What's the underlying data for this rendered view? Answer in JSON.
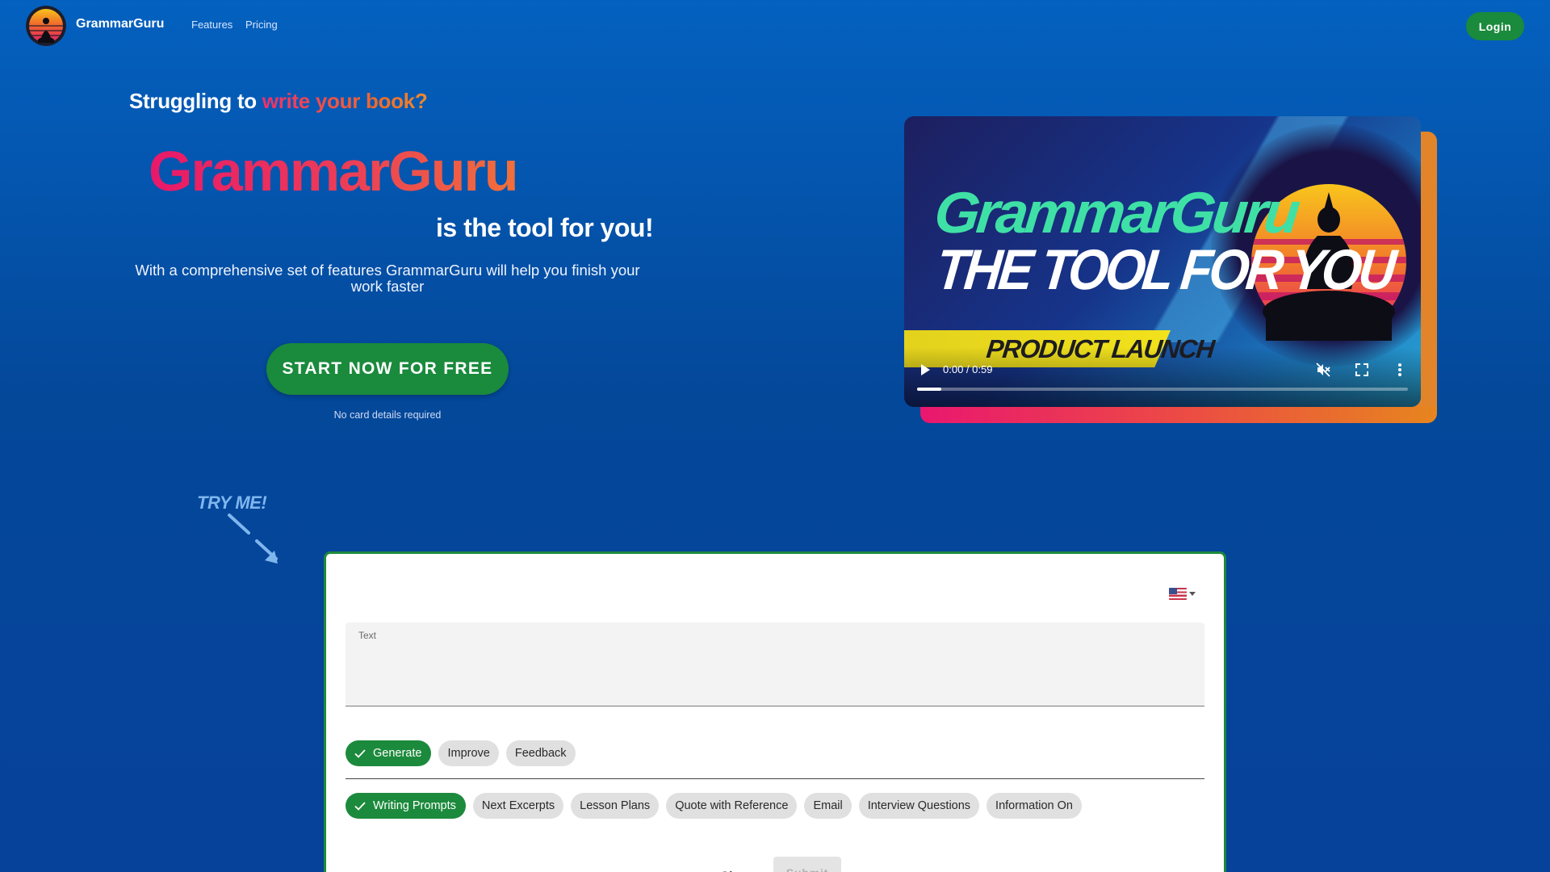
{
  "nav": {
    "brand": "GrammarGuru",
    "links": [
      "Features",
      "Pricing"
    ],
    "login_label": "Login"
  },
  "hero": {
    "headline_prefix": "Struggling to ",
    "headline_highlight": "write your book?",
    "brand": "GrammarGuru",
    "tagline": "is the tool for you!",
    "description": "With a comprehensive set of features GrammarGuru will help you finish your work faster",
    "cta_label": "START NOW FOR FREE",
    "cta_note": "No card details required"
  },
  "video": {
    "title_line1": "GrammarGuru",
    "title_line2": "THE TOOL FOR YOU",
    "banner": "PRODUCT LAUNCH",
    "time": "0:00 / 0:59",
    "progress": 0.05,
    "icons": [
      "play-icon",
      "mute-icon",
      "fullscreen-icon",
      "more-vert-icon"
    ]
  },
  "try_me": "TRY ME!",
  "tool": {
    "language_flag": "us-flag-icon",
    "text_label": "Text",
    "text_value": "",
    "modes": [
      {
        "label": "Generate",
        "selected": true
      },
      {
        "label": "Improve",
        "selected": false
      },
      {
        "label": "Feedback",
        "selected": false
      }
    ],
    "types": [
      {
        "label": "Writing Prompts",
        "selected": true
      },
      {
        "label": "Next Excerpts",
        "selected": false
      },
      {
        "label": "Lesson Plans",
        "selected": false
      },
      {
        "label": "Quote with Reference",
        "selected": false
      },
      {
        "label": "Email",
        "selected": false
      },
      {
        "label": "Interview Questions",
        "selected": false
      },
      {
        "label": "Information On",
        "selected": false
      }
    ],
    "clear_label": "Clear",
    "submit_label": "Submit"
  },
  "colors": {
    "accent_green": "#1c8a3c",
    "background_blue": "#0461bf",
    "brand_pink": "#e8186a",
    "brand_orange": "#f0703a"
  }
}
